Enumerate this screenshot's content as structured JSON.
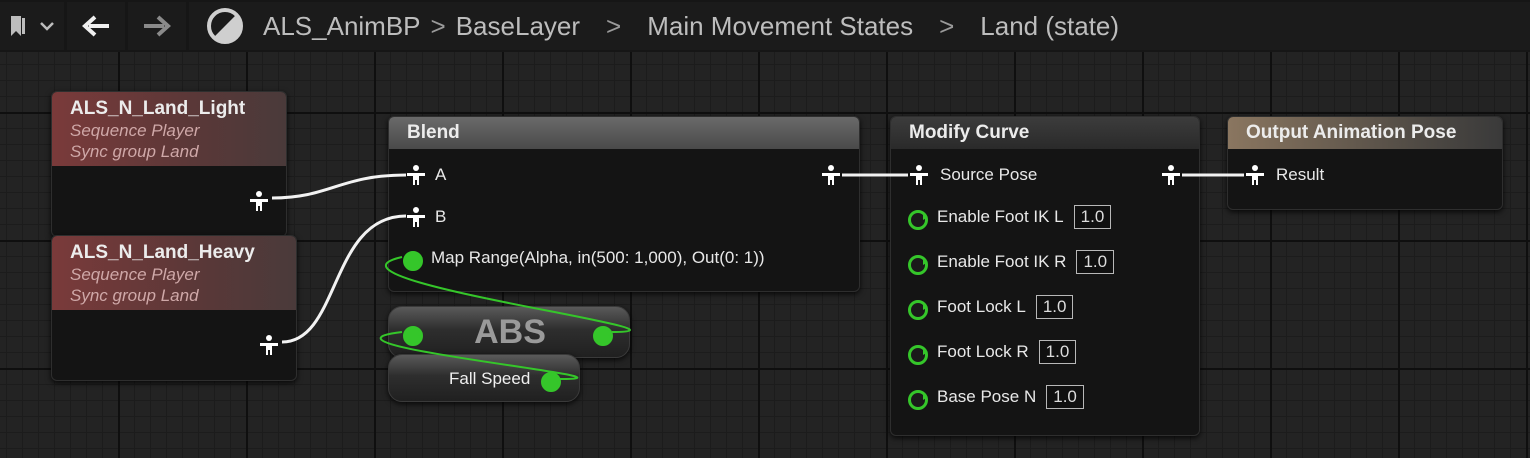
{
  "breadcrumb": {
    "items": [
      "ALS_AnimBP",
      "BaseLayer",
      "Main Movement States",
      "Land (state)"
    ],
    "separator": ">"
  },
  "nodes": {
    "land_light": {
      "title": "ALS_N_Land_Light",
      "line1": "Sequence Player",
      "line2": "Sync group Land"
    },
    "land_heavy": {
      "title": "ALS_N_Land_Heavy",
      "line1": "Sequence Player",
      "line2": "Sync group Land"
    },
    "blend": {
      "title": "Blend",
      "pin_a": "A",
      "pin_b": "B",
      "alpha": "Map Range(Alpha, in(500: 1,000), Out(0: 1))"
    },
    "abs": {
      "title": "ABS"
    },
    "fall_speed": {
      "label": "Fall Speed"
    },
    "modify_curve": {
      "title": "Modify Curve",
      "source_pose": "Source Pose",
      "pins": [
        {
          "label": "Enable Foot IK L",
          "value": "1.0"
        },
        {
          "label": "Enable Foot IK R",
          "value": "1.0"
        },
        {
          "label": "Foot Lock L",
          "value": "1.0"
        },
        {
          "label": "Foot Lock R",
          "value": "1.0"
        },
        {
          "label": "Base Pose N",
          "value": "1.0"
        }
      ]
    },
    "output": {
      "title": "Output Animation Pose",
      "result": "Result"
    }
  },
  "colors": {
    "float_pin": "#35c62a",
    "wire_exec": "#ffffff",
    "seq_header": "#7a3a3a",
    "output_header": "#8a7660"
  },
  "icons": [
    "bookmark-icon",
    "chevron-down-icon",
    "back-arrow-icon",
    "forward-arrow-icon",
    "graph-type-icon",
    "pose-pin-icon",
    "float-pin-icon"
  ]
}
